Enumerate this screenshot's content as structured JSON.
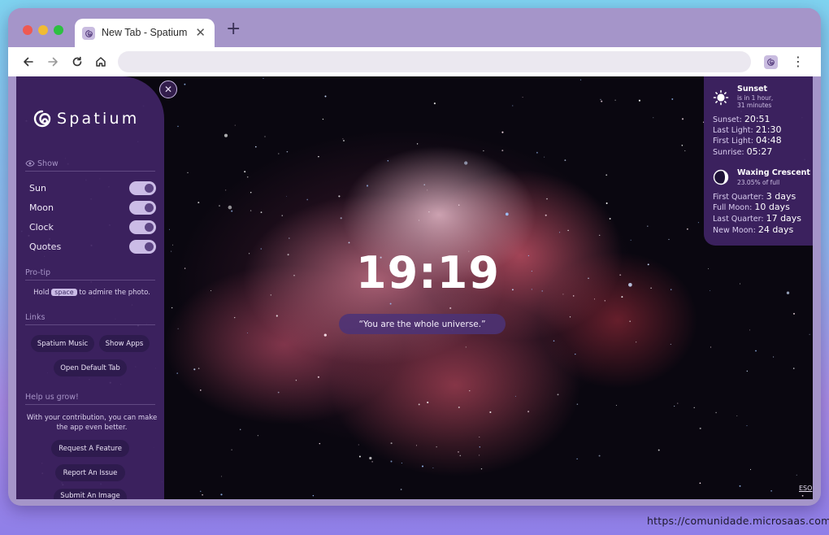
{
  "browser": {
    "tab_title": "New Tab - Spatium",
    "tab_close": "✕",
    "new_tab": "+",
    "menu": "⋮"
  },
  "sidebar": {
    "close": "✕",
    "logo": "Spatium",
    "show_heading": "Show",
    "toggles": [
      {
        "label": "Sun",
        "on": true
      },
      {
        "label": "Moon",
        "on": true
      },
      {
        "label": "Clock",
        "on": true
      },
      {
        "label": "Quotes",
        "on": true
      }
    ],
    "protip_heading": "Pro-tip",
    "protip_before": "Hold",
    "protip_key": "space",
    "protip_after": "to admire the photo.",
    "links_heading": "Links",
    "links": {
      "music": "Spatium Music",
      "apps": "Show Apps",
      "default_tab": "Open Default Tab"
    },
    "help_heading": "Help us grow!",
    "help_text": "With your contribution, you can make the app even better.",
    "help_buttons": {
      "feature": "Request A Feature",
      "issue": "Report An Issue",
      "image": "Submit An Image"
    }
  },
  "main": {
    "clock": "19:19",
    "quote": "“You are the whole universe.”",
    "credit": "ESO"
  },
  "sun": {
    "title": "Sunset",
    "sub1": "is in 1 hour,",
    "sub2": "31 minutes",
    "rows": [
      {
        "label": "Sunset:",
        "value": "20:51"
      },
      {
        "label": "Last Light:",
        "value": "21:30"
      },
      {
        "label": "First Light:",
        "value": "04:48"
      },
      {
        "label": "Sunrise:",
        "value": "05:27"
      }
    ]
  },
  "moon": {
    "title": "Waxing Crescent",
    "sub": "23.05% of full",
    "rows": [
      {
        "label": "First Quarter:",
        "value": "3 days"
      },
      {
        "label": "Full Moon:",
        "value": "10 days"
      },
      {
        "label": "Last Quarter:",
        "value": "17 days"
      },
      {
        "label": "New Moon:",
        "value": "24 days"
      }
    ]
  },
  "watermark": "https://comunidade.microsaas.com.br",
  "colors": {
    "panel": "#402464",
    "accent": "#cbbce6",
    "pill": "#2e1b4e"
  }
}
